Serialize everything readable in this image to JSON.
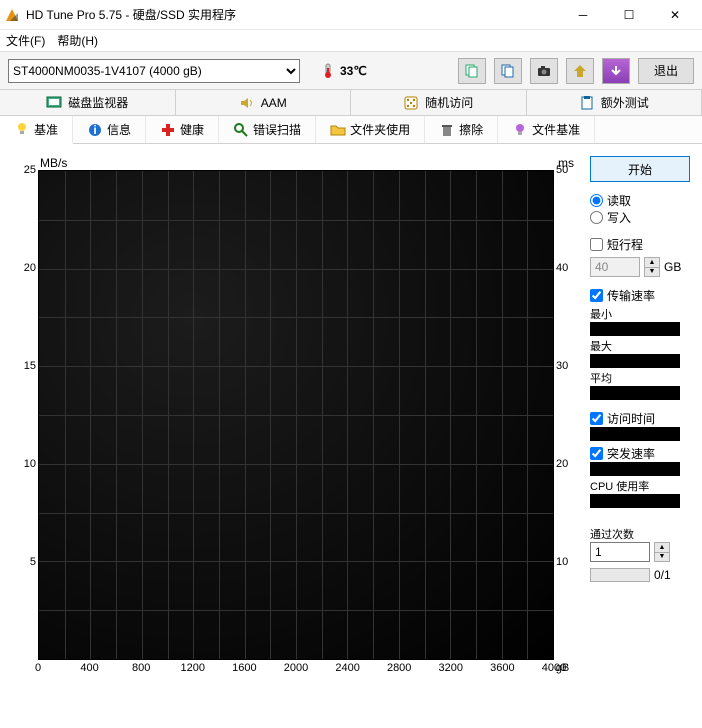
{
  "window": {
    "title": "HD Tune Pro 5.75 - 硬盘/SSD 实用程序"
  },
  "menu": {
    "file": "文件(F)",
    "help": "帮助(H)"
  },
  "toolbar": {
    "drive": "ST4000NM0035-1V4107 (4000 gB)",
    "temp": "33℃",
    "exit": "退出"
  },
  "tabs1": {
    "disk_monitor": "磁盘监视器",
    "aam": "AAM",
    "random_access": "随机访问",
    "extra_tests": "额外测试"
  },
  "tabs2": {
    "benchmark": "基准",
    "info": "信息",
    "health": "健康",
    "error_scan": "错误扫描",
    "folder_usage": "文件夹使用",
    "erase": "擦除",
    "file_benchmark": "文件基准"
  },
  "chart": {
    "ylabel_left": "MB/s",
    "ylabel_right": "ms",
    "xunit": "gB"
  },
  "chart_data": {
    "type": "line",
    "series": [],
    "x": [
      0,
      400,
      800,
      1200,
      1600,
      2000,
      2400,
      2800,
      3200,
      3600,
      4000
    ],
    "y_left_ticks": [
      5,
      10,
      15,
      20,
      25
    ],
    "y_right_ticks": [
      10,
      20,
      30,
      40,
      50
    ],
    "xlabel": "gB",
    "y_left_label": "MB/s",
    "y_right_label": "ms",
    "xlim": [
      0,
      4000
    ],
    "y_left_lim": [
      0,
      25
    ],
    "y_right_lim": [
      0,
      50
    ]
  },
  "side": {
    "start": "开始",
    "read": "读取",
    "write": "写入",
    "short_stroke": "短行程",
    "short_stroke_val": "40",
    "gb": "GB",
    "transfer_rate": "传输速率",
    "min": "最小",
    "max": "最大",
    "avg": "平均",
    "access_time": "访问时间",
    "burst_rate": "突发速率",
    "cpu_usage": "CPU 使用率",
    "passes": "通过次数",
    "passes_val": "1",
    "progress": "0/1"
  }
}
